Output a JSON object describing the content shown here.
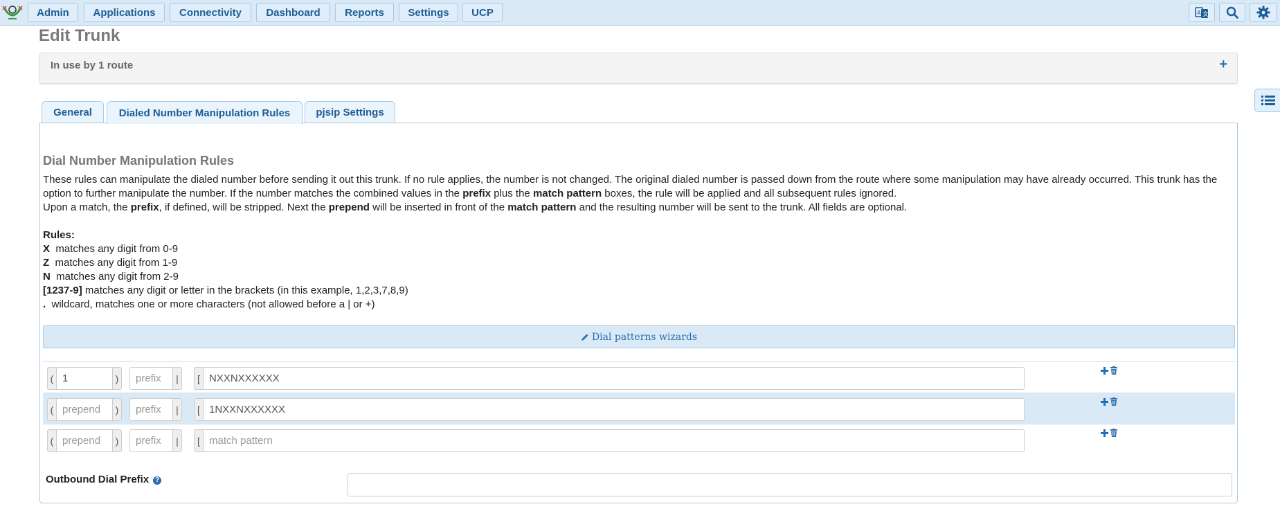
{
  "nav": {
    "items": [
      "Admin",
      "Applications",
      "Connectivity",
      "Dashboard",
      "Reports",
      "Settings",
      "UCP"
    ],
    "icons": [
      "language-icon",
      "search-icon",
      "gear-icon"
    ]
  },
  "page_title": "Edit Trunk",
  "route_panel": {
    "label": "In use by 1 route",
    "toggle": "+"
  },
  "tabs": [
    "General",
    "Dialed Number Manipulation Rules",
    "pjsip Settings"
  ],
  "active_tab": "Dialed Number Manipulation Rules",
  "section": {
    "title": "Dial Number Manipulation Rules",
    "para1": [
      "These rules can manipulate the dialed number before sending it out this trunk. If no rule applies, the number is not changed. The original dialed number is passed down from the route where some manipulation may have already occurred. This trunk has the option to further manipulate the number. If the number matches the combined values in the ",
      "prefix",
      " plus the ",
      "match pattern",
      " boxes, the rule will be applied and all subsequent rules ignored."
    ],
    "para2": [
      "Upon a match, the ",
      "prefix",
      ", if defined, will be stripped. Next the ",
      "prepend",
      " will be inserted in front of the ",
      "match pattern",
      " and the resulting number will be sent to the trunk. All fields are optional."
    ],
    "rules_title": "Rules:",
    "rules": [
      {
        "key": "X",
        "text": "  matches any digit from 0-9"
      },
      {
        "key": "Z",
        "text": "  matches any digit from 1-9"
      },
      {
        "key": "N",
        "text": "  matches any digit from 2-9"
      },
      {
        "key": "[1237-9]",
        "text": " matches any digit or letter in the brackets (in this example, 1,2,3,7,8,9)"
      },
      {
        "key": ".",
        "text": "  wildcard, matches one or more characters (not allowed before a | or +)"
      }
    ],
    "wizard_label": "Dial patterns wizards"
  },
  "placeholders": {
    "prepend": "prepend",
    "prefix": "prefix",
    "match": "match pattern"
  },
  "brackets": {
    "open_paren": "(",
    "close_paren": ")",
    "pipe": "|",
    "open_bracket": "["
  },
  "patterns": [
    {
      "prepend": "1",
      "prefix": "",
      "match": "NXXNXXXXXX"
    },
    {
      "prepend": "",
      "prefix": "",
      "match": "1NXXNXXXXXX"
    },
    {
      "prepend": "",
      "prefix": "",
      "match": ""
    }
  ],
  "outbound_dial_prefix": {
    "label": "Outbound Dial Prefix",
    "value": "",
    "help": "?"
  },
  "colors": {
    "accent": "#2a6db0",
    "nav_bg": "#d9eaf6",
    "title_gray": "#7a7a7a"
  }
}
